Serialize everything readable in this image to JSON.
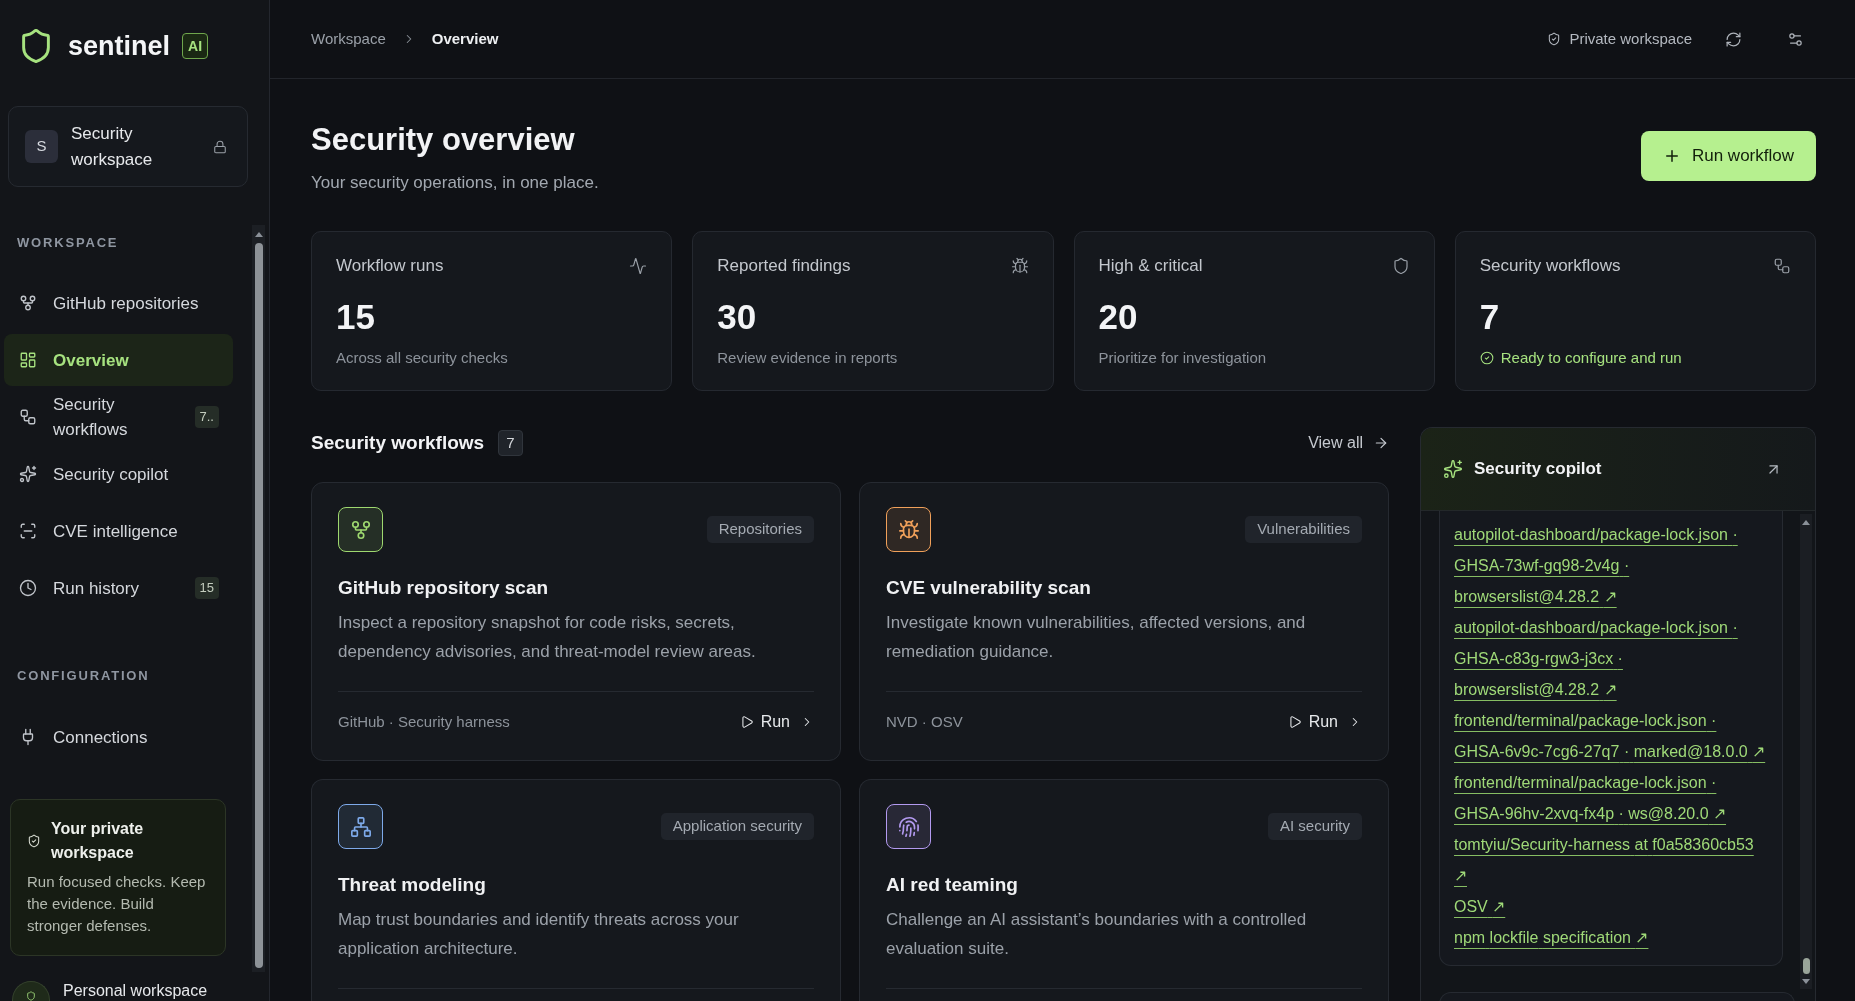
{
  "sidebar": {
    "brand": {
      "name": "sentinel",
      "badge": "AI"
    },
    "workspace_switcher": {
      "avatar": "S",
      "name": "Security workspace"
    },
    "sections": [
      {
        "heading": "WORKSPACE",
        "items": [
          {
            "label": "GitHub repositories",
            "selected": false
          },
          {
            "label": "Overview",
            "selected": true
          },
          {
            "label": "Security workflows",
            "badge": "7..",
            "selected": false
          },
          {
            "label": "Security copilot",
            "selected": false
          },
          {
            "label": "CVE intelligence",
            "selected": false
          },
          {
            "label": "Run history",
            "badge": "15",
            "selected": false
          }
        ]
      },
      {
        "heading": "CONFIGURATION",
        "items": [
          {
            "label": "Connections",
            "selected": false
          }
        ]
      }
    ],
    "info_card": {
      "title": "Your private workspace",
      "body": "Run focused checks. Keep the evidence. Build stronger defenses."
    },
    "account": {
      "name": "Personal workspace"
    }
  },
  "topbar": {
    "breadcrumbs": [
      {
        "label": "Workspace",
        "current": false
      },
      {
        "label": "Overview",
        "current": true
      }
    ],
    "workspace_label": "Private workspace"
  },
  "header": {
    "title": "Security overview",
    "subtitle": "Your security operations, in one place.",
    "action": "Run workflow"
  },
  "stats": [
    {
      "label": "Workflow runs",
      "value": "15",
      "note": "Across all security checks",
      "kind": "plain"
    },
    {
      "label": "Reported findings",
      "value": "30",
      "note": "Review evidence in reports",
      "kind": "plain"
    },
    {
      "label": "High & critical",
      "value": "20",
      "note": "Prioritize for investigation",
      "kind": "plain"
    },
    {
      "label": "Security workflows",
      "value": "7",
      "note": "Ready to configure and run",
      "kind": "ready"
    }
  ],
  "workflows": {
    "title": "Security workflows",
    "count": "7",
    "view_all": "View all",
    "items": [
      {
        "title": "GitHub repository scan",
        "tag": "Repositories",
        "description": "Inspect a repository snapshot for code risks, secrets, dependency advisories, and threat-model review areas.",
        "sources": "GitHub · Security harness",
        "run": "Run",
        "color": "#9ed86f"
      },
      {
        "title": "CVE vulnerability scan",
        "tag": "Vulnerabilities",
        "description": "Investigate known vulnerabilities, affected versions, and remediation guidance.",
        "sources": "NVD · OSV",
        "run": "Run",
        "color": "#f0a05a"
      },
      {
        "title": "Threat modeling",
        "tag": "Application security",
        "description": "Map trust boundaries and identify threats across your application architecture.",
        "color": "#7eaaea"
      },
      {
        "title": "AI red teaming",
        "tag": "AI security",
        "description": "Challenge an AI assistant’s boundaries with a controlled evaluation suite.",
        "color": "#b39af0"
      }
    ]
  },
  "copilot": {
    "title": "Security copilot",
    "links": [
      "autopilot-dashboard/package-lock.json · GHSA-73wf-gq98-2v4g · browserslist@4.28.2 ↗",
      "autopilot-dashboard/package-lock.json · GHSA-c83g-rgw3-j3cx · browserslist@4.28.2 ↗",
      "frontend/terminal/package-lock.json · GHSA-6v9c-7cg6-27q7 · marked@18.0.0 ↗",
      "frontend/terminal/package-lock.json · GHSA-96hv-2xvq-fx4p · ws@8.20.0 ↗",
      "tomtyiu/Security-harness at f0a58360cb53 ↗",
      "OSV ↗",
      "npm lockfile specification ↗"
    ]
  }
}
